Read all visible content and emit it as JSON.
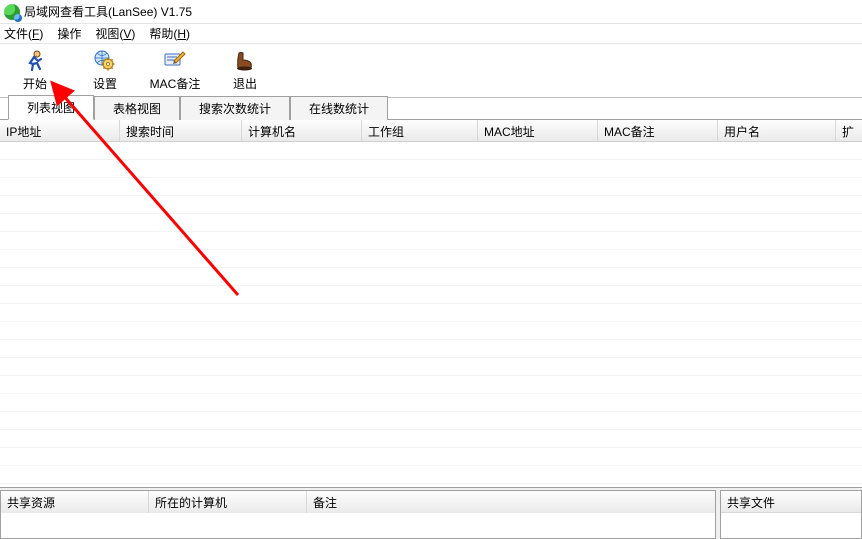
{
  "titlebar": {
    "title": "局域网查看工具(LanSee) V1.75"
  },
  "menu": {
    "file": "文件(",
    "file_u": "F",
    "file_end": ")",
    "action": "操作",
    "view": "视图(",
    "view_u": "V",
    "view_end": ")",
    "help": "帮助(",
    "help_u": "H",
    "help_end": ")"
  },
  "toolbar": {
    "start": "开始",
    "settings": "设置",
    "mac_remark": "MAC备注",
    "exit": "退出"
  },
  "tabs": {
    "list_view": "列表视图",
    "table_view": "表格视图",
    "search_stats": "搜索次数统计",
    "online_stats": "在线数统计"
  },
  "columns": {
    "ip": "IP地址",
    "search_time": "搜索时间",
    "computer_name": "计算机名",
    "workgroup": "工作组",
    "mac": "MAC地址",
    "mac_remark": "MAC备注",
    "username": "用户名",
    "extra": "扩"
  },
  "bottom_left_cols": {
    "share_resource": "共享资源",
    "host_computer": "所在的计算机",
    "remark": "备注"
  },
  "bottom_right": {
    "share_file": "共享文件"
  }
}
